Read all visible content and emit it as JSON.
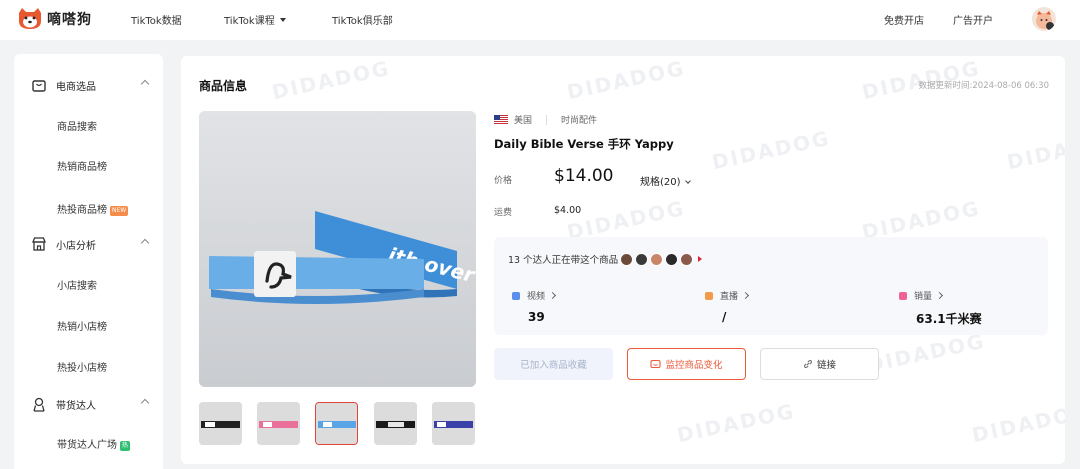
{
  "app": {
    "name": "嘀嗒狗"
  },
  "nav": {
    "tiktok_data": "TikTok数据",
    "tiktok_course": "TikTok课程",
    "tiktok_club": "TikTok俱乐部",
    "open_store": "免费开店",
    "ad_account": "广告开户"
  },
  "sidebar": {
    "groups": [
      {
        "label": "电商选品",
        "icon": "shopping-bag-icon",
        "items": [
          {
            "label": "商品搜索"
          },
          {
            "label": "热销商品榜"
          },
          {
            "label": "热投商品榜",
            "badge": "NEW"
          }
        ]
      },
      {
        "label": "小店分析",
        "icon": "store-icon",
        "items": [
          {
            "label": "小店搜索"
          },
          {
            "label": "热销小店榜"
          },
          {
            "label": "热投小店榜"
          }
        ]
      },
      {
        "label": "带货达人",
        "icon": "person-badge-icon",
        "items": [
          {
            "label": "带货达人广场",
            "badge": "热"
          }
        ]
      }
    ]
  },
  "main": {
    "title": "商品信息",
    "update_time": "数据更新时间:2024-08-06 06:30",
    "watermark": "DIDADOG",
    "product": {
      "country": "美国",
      "category": "时尚配件",
      "title": "Daily Bible Verse 手环 Yappy",
      "price_label": "价格",
      "price": "$14.00",
      "spec": "规格(20)",
      "shipping_label": "运费",
      "shipping": "$4.00",
      "band_text": "ith over",
      "thumbnail_count": 5,
      "active_thumbnail": 3
    },
    "stats": {
      "creators_text": "13 个达人正在带这个商品",
      "video": {
        "label": "视频",
        "value": "39",
        "color": "#5b8def"
      },
      "live": {
        "label": "直播",
        "value": "/",
        "color": "#f2994a"
      },
      "sales": {
        "label": "销量",
        "value": "63.1千米赛",
        "color": "#f06292"
      }
    },
    "buttons": {
      "favorite": "已加入商品收藏",
      "monitor": "监控商品变化",
      "link": "链接"
    }
  },
  "colors": {
    "accent": "#ea5a3a",
    "badge_new": "#f58c4b",
    "badge_hot": "#2fbf71"
  }
}
